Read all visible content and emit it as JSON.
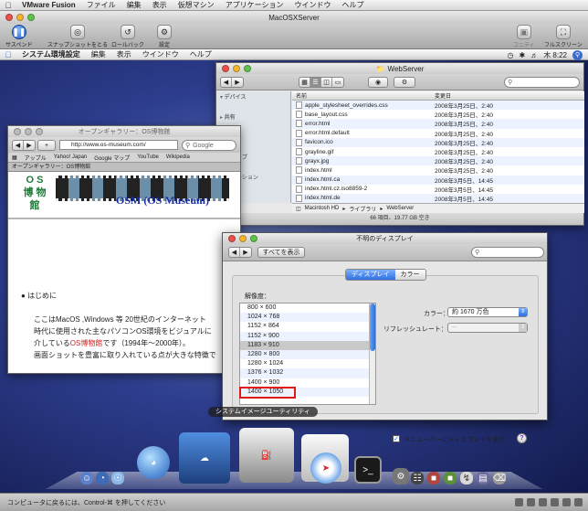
{
  "host_menubar": {
    "app": "VMware Fusion",
    "items": [
      "ファイル",
      "編集",
      "表示",
      "仮想マシン",
      "アプリケーション",
      "ウインドウ",
      "ヘルプ"
    ]
  },
  "vm_window": {
    "title": "MacOSXServer",
    "toolbar": {
      "suspend": "サスペンド",
      "snapshot": "スナップショットをとる",
      "rollback": "ロールバック",
      "settings": "設定",
      "unity": "ユニティ",
      "fullscreen": "フルスクリーン"
    },
    "status_text": "コンピュータに戻るには、Control-⌘ を押してください"
  },
  "guest_menubar": {
    "app": "システム環境設定",
    "items": [
      "編集",
      "表示",
      "ウインドウ",
      "ヘルプ"
    ],
    "clock": "木 8:22"
  },
  "finder": {
    "title": "WebServer",
    "sidebar": [
      {
        "label": "▾ デバイス",
        "header": true
      },
      {
        "label": "",
        "header": false
      },
      {
        "label": "▸ 共有",
        "header": true
      },
      {
        "label": "",
        "header": false
      },
      {
        "label": "▾ 場所",
        "header": true
      },
      {
        "label": "",
        "header": false
      },
      {
        "label": "スクトップ",
        "header": false
      },
      {
        "label": "min",
        "header": false
      },
      {
        "label": "プリケーション",
        "header": false
      },
      {
        "label": "類",
        "header": false
      }
    ],
    "columns": {
      "name": "名前",
      "date": "変更日"
    },
    "files": [
      {
        "name": "apple_stylesheet_overrides.css",
        "date": "2008年3月25日、2:40"
      },
      {
        "name": "base_layout.css",
        "date": "2008年3月25日、2:40"
      },
      {
        "name": "error.html",
        "date": "2008年3月25日、2:40"
      },
      {
        "name": "error.html.default",
        "date": "2008年3月25日、2:40"
      },
      {
        "name": "favicon.ico",
        "date": "2008年3月25日、2:40"
      },
      {
        "name": "grayline.gif",
        "date": "2008年3月25日、2:40"
      },
      {
        "name": "grayx.jpg",
        "date": "2008年3月25日、2:40"
      },
      {
        "name": "index.html",
        "date": "2008年3月25日、2:40"
      },
      {
        "name": "index.html.ca",
        "date": "2008年3月5日、14:45"
      },
      {
        "name": "index.html.cz.iso8859-2",
        "date": "2008年3月5日、14:45"
      },
      {
        "name": "index.html.de",
        "date": "2008年3月5日、14:45"
      }
    ],
    "path": [
      "Macintosh HD",
      "ライブラリ",
      "WebServer"
    ],
    "status": "66 項目、19.77 GB 空き"
  },
  "safari": {
    "title": "オープンギャラリー：OS博物館",
    "url": "http://www.os-museum.com/",
    "search_placeholder": "Google",
    "bookmarks": [
      "アップル",
      "Yahoo! Japan",
      "Google マップ",
      "YouTube",
      "Wikipedia"
    ],
    "tab": "オープンギャラリー：OS博物館",
    "logo_line1": "O S",
    "logo_line2": "博 物 館",
    "site_name": "OSM (OS Museum)",
    "bullet": "はじめに",
    "para_line1": "ここはMacOS ,Windows 等 20世紀のインターネット",
    "para_line2": "時代に使用された主なパソコンOS環境をビジュアルに",
    "para_line3_pre": "介している",
    "para_line3_link": "OS博物館",
    "para_line3_post": "です（1994年〜2000年）。",
    "para_line4": "画面ショットを豊富に取り入れている点が大きな特徴で"
  },
  "display_prefs": {
    "title": "不明のディスプレイ",
    "show_all": "すべてを表示",
    "tabs": [
      "ディスプレイ",
      "カラー"
    ],
    "resolution_label": "解像度：",
    "resolutions": [
      "800 × 600",
      "1024 × 768",
      "1152 × 864",
      "1152 × 900",
      "1183 × 910",
      "1280 × 800",
      "1280 × 1024",
      "1376 × 1032",
      "1400 × 900",
      "1400 × 1050"
    ],
    "selected_resolution": "1183 × 910",
    "color_label": "カラー：",
    "color_value": "約 1670 万色",
    "refresh_label": "リフレッシュレート：",
    "refresh_value": "--",
    "menubar_checkbox": "メニューバーにディスプレイを表示",
    "menubar_checked": true
  },
  "dock": {
    "hover_label": "システムイメージユーティリティ"
  }
}
